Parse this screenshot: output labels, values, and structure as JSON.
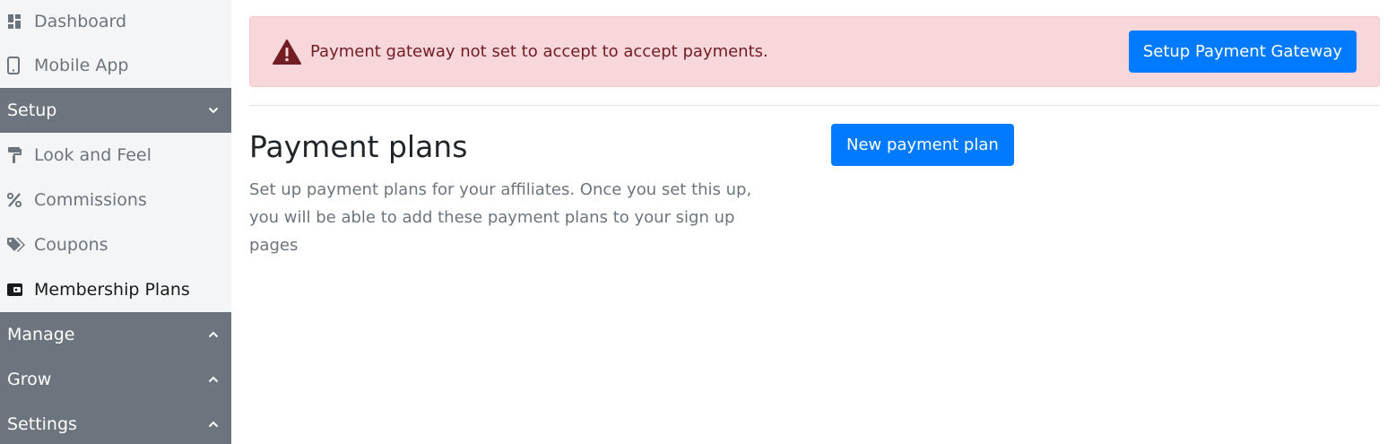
{
  "sidebar": {
    "top_items": [
      {
        "label": "Dashboard",
        "icon": "dashboard-icon"
      },
      {
        "label": "Mobile App",
        "icon": "mobile-icon"
      }
    ],
    "setup": {
      "label": "Setup",
      "expanded": true,
      "items": [
        {
          "label": "Look and Feel",
          "icon": "paint-roller-icon"
        },
        {
          "label": "Commissions",
          "icon": "percent-icon"
        },
        {
          "label": "Coupons",
          "icon": "tags-icon"
        },
        {
          "label": "Membership Plans",
          "icon": "wallet-icon",
          "active": true
        }
      ]
    },
    "sections": [
      {
        "label": "Manage",
        "expanded": false
      },
      {
        "label": "Grow",
        "expanded": false
      },
      {
        "label": "Settings",
        "expanded": false
      }
    ]
  },
  "alert": {
    "icon": "warning-icon",
    "text": "Payment gateway not set to accept to accept payments.",
    "button_label": "Setup Payment Gateway"
  },
  "plans": {
    "title": "Payment plans",
    "description": "Set up payment plans for your affiliates. Once you set this up, you will be able to add these payment plans to your sign up pages",
    "new_button_label": "New payment plan"
  },
  "colors": {
    "primary": "#007bff",
    "alert_bg": "#f8d7da",
    "alert_text": "#721c24",
    "sidebar_section_bg": "#6c757d",
    "sidebar_bg": "#f4f5f7"
  }
}
